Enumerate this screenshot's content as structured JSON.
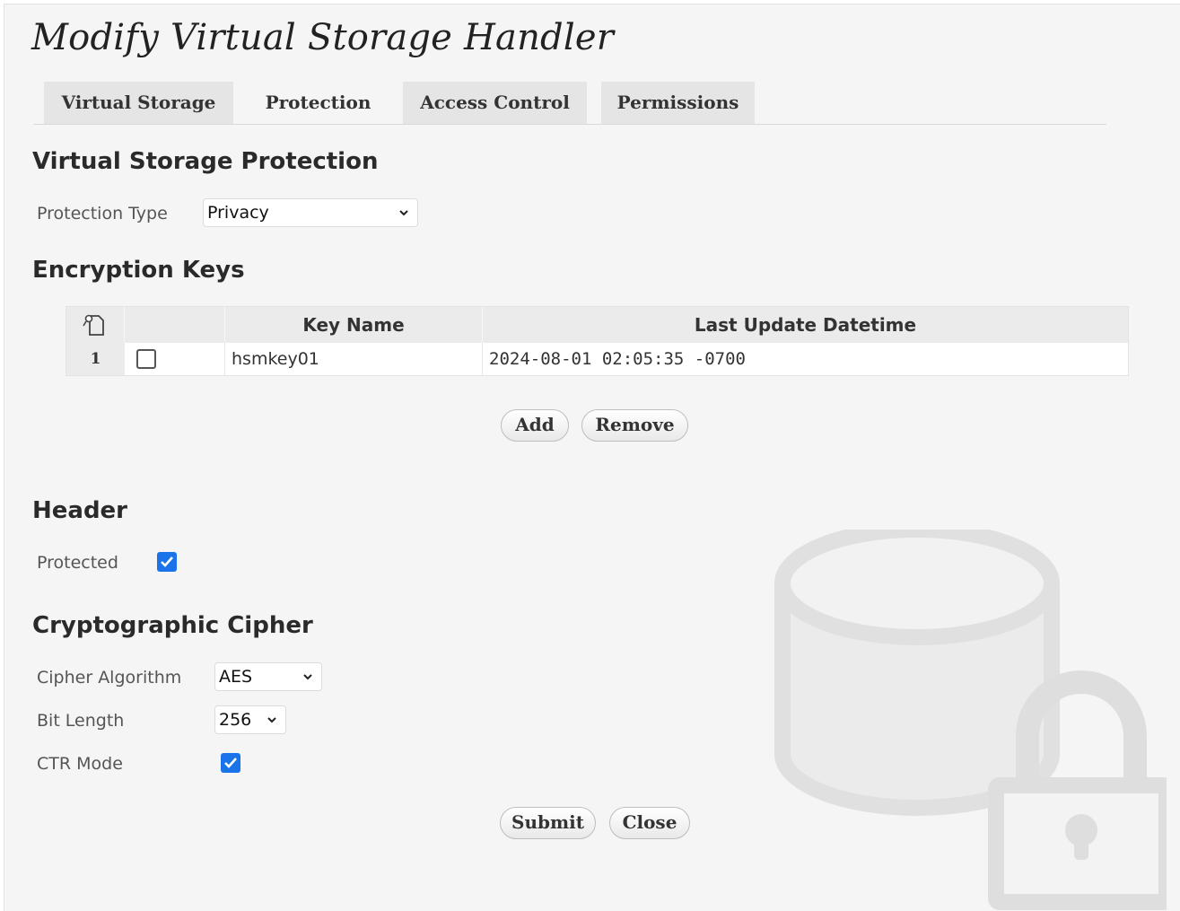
{
  "page_title": "Modify Virtual Storage Handler",
  "tabs": [
    {
      "label": "Virtual Storage",
      "active": false
    },
    {
      "label": "Protection",
      "active": true
    },
    {
      "label": "Access Control",
      "active": false
    },
    {
      "label": "Permissions",
      "active": false
    }
  ],
  "protection": {
    "section_title": "Virtual Storage Protection",
    "type_label": "Protection Type",
    "type_value": "Privacy"
  },
  "encryption_keys": {
    "section_title": "Encryption Keys",
    "columns": {
      "key_name": "Key Name",
      "last_update": "Last Update Datetime"
    },
    "rows": [
      {
        "index": "1",
        "selected": false,
        "key_name": "hsmkey01",
        "last_update": "2024-08-01 02:05:35 -0700"
      }
    ],
    "add_label": "Add",
    "remove_label": "Remove"
  },
  "header": {
    "section_title": "Header",
    "protected_label": "Protected",
    "protected_checked": true
  },
  "cipher": {
    "section_title": "Cryptographic Cipher",
    "algorithm_label": "Cipher Algorithm",
    "algorithm_value": "AES",
    "bit_length_label": "Bit Length",
    "bit_length_value": "256",
    "ctr_label": "CTR Mode",
    "ctr_checked": true
  },
  "actions": {
    "submit_label": "Submit",
    "close_label": "Close"
  },
  "colors": {
    "checkbox_accent": "#1a73e8",
    "panel_background": "#f5f5f5",
    "decor_gray": "#e0e0e0"
  },
  "icons": {
    "grid_corner": "column-menu-icon",
    "select_chevron": "chevron-down-icon",
    "decor": "locked-storage-icon"
  }
}
